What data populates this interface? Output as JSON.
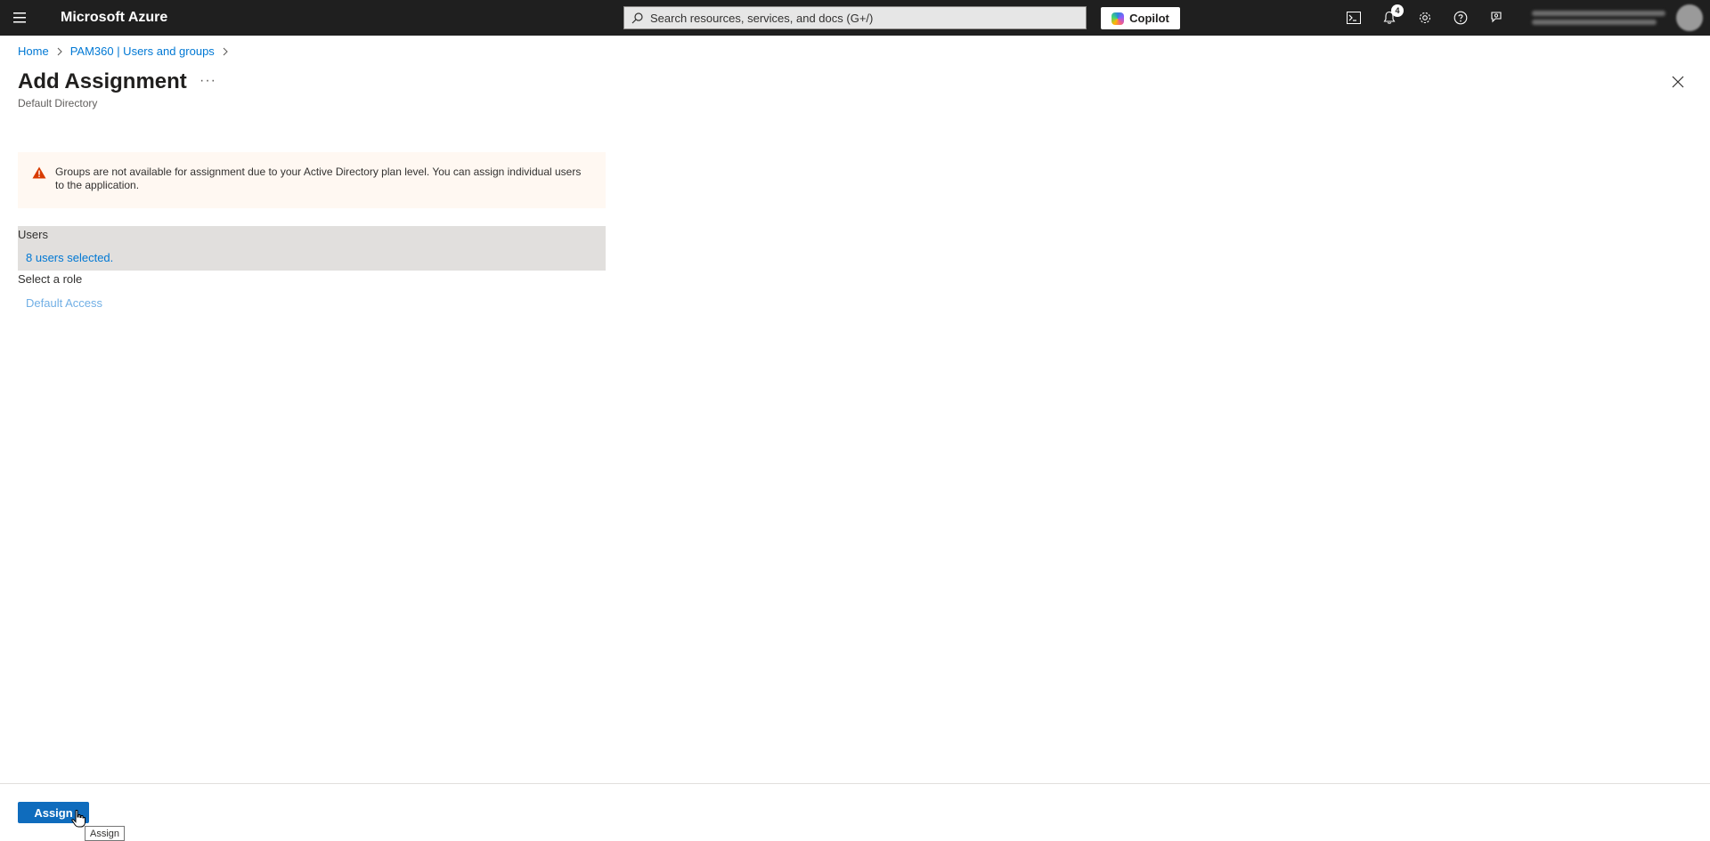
{
  "header": {
    "brand": "Microsoft Azure",
    "search_placeholder": "Search resources, services, and docs (G+/)",
    "copilot_label": "Copilot",
    "notification_count": "4",
    "icons": [
      "menu-icon",
      "cloud-shell-icon",
      "bell-icon",
      "gear-icon",
      "help-icon",
      "feedback-icon"
    ]
  },
  "breadcrumb": {
    "items": [
      "Home",
      "PAM360 | Users and groups"
    ]
  },
  "page": {
    "title": "Add Assignment",
    "more_label": "···",
    "subtitle": "Default Directory"
  },
  "warning": {
    "text": "Groups are not available for assignment due to your Active Directory plan level. You can assign individual users to the application.",
    "color": "#d83b01"
  },
  "users": {
    "label": "Users",
    "value": "8 users selected."
  },
  "role": {
    "label": "Select a role",
    "value": "Default Access"
  },
  "footer": {
    "assign_label": "Assign",
    "tooltip": "Assign"
  },
  "colors": {
    "topbar": "#1f1f1f",
    "link": "#0078d4",
    "primary_button": "#0f6cbd",
    "warning_bg": "#fff8f2",
    "selected_section_bg": "#e1dfdd"
  }
}
